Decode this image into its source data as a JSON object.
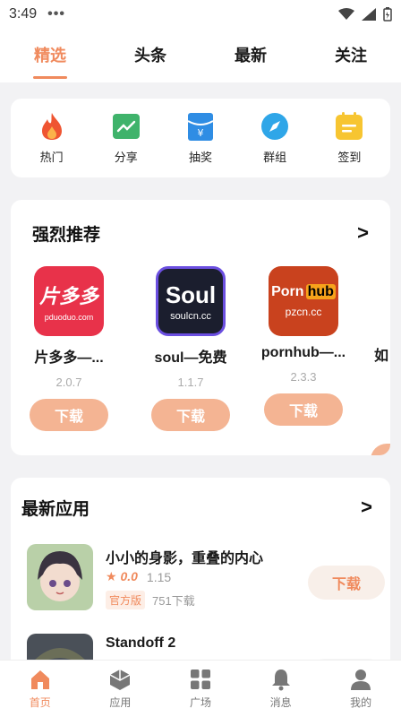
{
  "status": {
    "time": "3:49",
    "dots": "•••"
  },
  "tabs": [
    {
      "label": "精选",
      "active": true
    },
    {
      "label": "头条"
    },
    {
      "label": "最新"
    },
    {
      "label": "关注"
    }
  ],
  "quick": [
    {
      "label": "热门",
      "icon": "fire-icon"
    },
    {
      "label": "分享",
      "icon": "chart-icon"
    },
    {
      "label": "抽奖",
      "icon": "gift-icon"
    },
    {
      "label": "群组",
      "icon": "compass-icon"
    },
    {
      "label": "签到",
      "icon": "calendar-icon"
    }
  ],
  "recommend": {
    "title": "强烈推荐",
    "more": ">",
    "apps": [
      {
        "name": "片多多—...",
        "version": "2.0.7",
        "button": "下载",
        "logo_text": "片多多",
        "logo_sub": "pduoduo.com",
        "color": "#e8324a"
      },
      {
        "name": "soul—免费",
        "version": "1.1.7",
        "button": "下载",
        "logo_text": "Soul",
        "logo_sub": "soulcn.cc",
        "color": "#1b1e2e"
      },
      {
        "name": "pornhub—...",
        "version": "2.3.3",
        "button": "下载",
        "logo_text": "Porn",
        "logo_text2": "hub",
        "logo_sub": "pzcn.cc",
        "color": "#c9421e"
      }
    ],
    "peek_name": "如"
  },
  "latest": {
    "title": "最新应用",
    "more": ">",
    "items": [
      {
        "title": "小小的身影，重叠的内心",
        "rating": "★ 0.0",
        "version": "1.15",
        "tag": "官方版",
        "downloads": "751下载",
        "button": "下载"
      },
      {
        "title": "Standoff 2"
      }
    ]
  },
  "bottom_nav": [
    {
      "label": "首页",
      "icon": "home-icon",
      "active": true
    },
    {
      "label": "应用",
      "icon": "cube-icon"
    },
    {
      "label": "广场",
      "icon": "grid-icon"
    },
    {
      "label": "消息",
      "icon": "bell-icon"
    },
    {
      "label": "我的",
      "icon": "user-icon"
    }
  ],
  "colors": {
    "accent": "#f08a5d",
    "button_bg": "#f4b493"
  }
}
